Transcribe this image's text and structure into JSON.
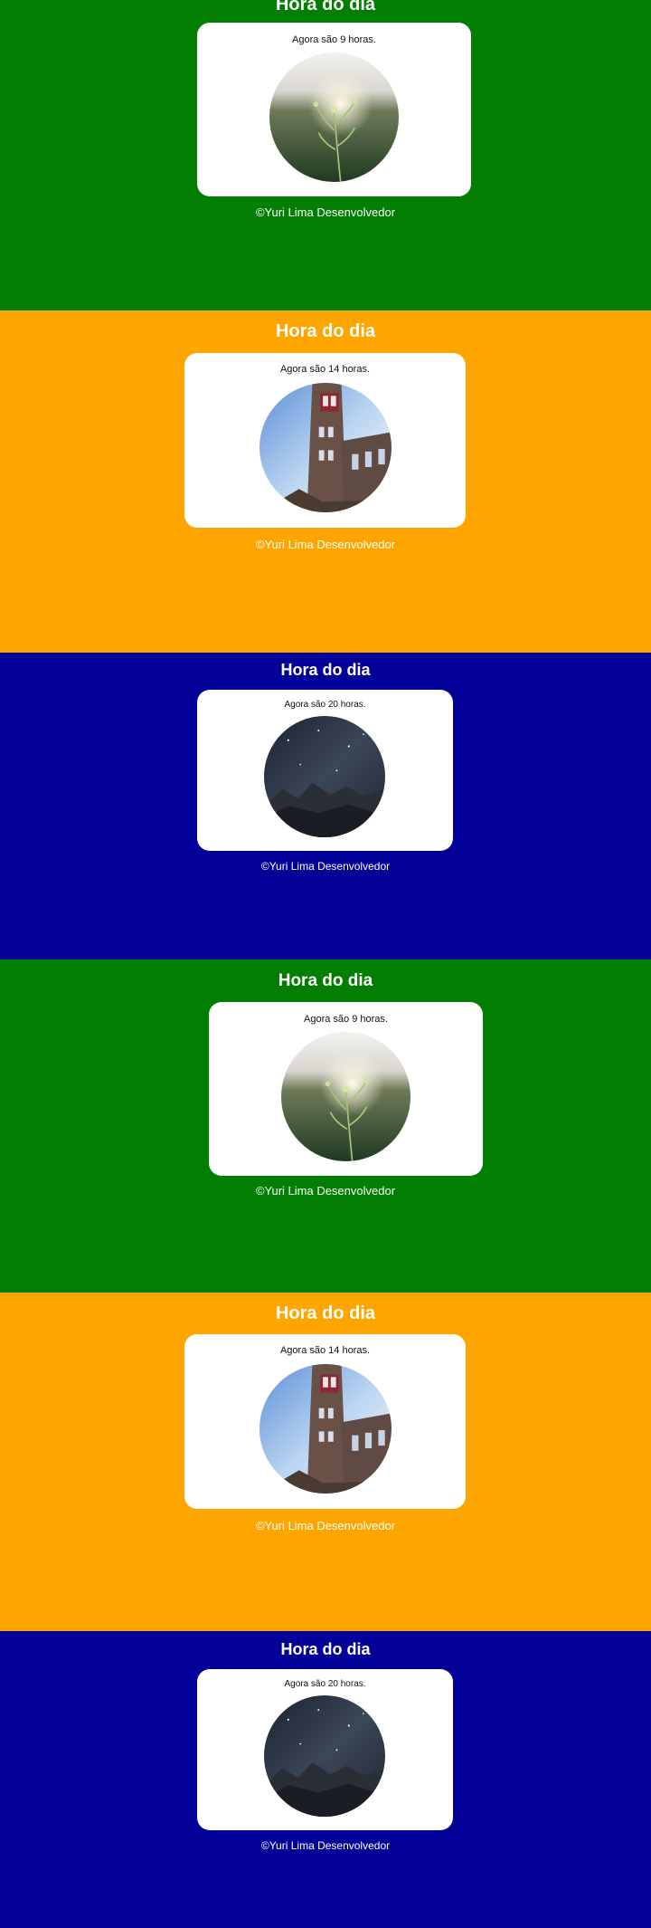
{
  "colors": {
    "morning_bg": "#027E02",
    "afternoon_bg": "#FFA500",
    "night_bg": "#020096",
    "card_bg": "#FFFFFF",
    "text_light": "#FFFFFF",
    "text_dark": "#111111"
  },
  "sections": [
    {
      "period": "morning",
      "title": "Hora do dia",
      "message": "Agora são 9 horas.",
      "image_icon": "sunrise-plant-photo",
      "footer": "©Yuri Lima Desenvolvedor"
    },
    {
      "period": "afternoon",
      "title": "Hora do dia",
      "message": "Agora são 14 horas.",
      "image_icon": "clock-tower-photo",
      "footer": "©Yuri Lima Desenvolvedor"
    },
    {
      "period": "night",
      "title": "Hora do dia",
      "message": "Agora são 20 horas.",
      "image_icon": "night-sky-mountains-photo",
      "footer": "©Yuri Lima Desenvolvedor"
    },
    {
      "period": "morning",
      "title": "Hora do dia",
      "message": "Agora são 9 horas.",
      "image_icon": "sunrise-plant-photo",
      "footer": "©Yuri Lima Desenvolvedor"
    },
    {
      "period": "afternoon",
      "title": "Hora do dia",
      "message": "Agora são 14 horas.",
      "image_icon": "clock-tower-photo",
      "footer": "©Yuri Lima Desenvolvedor"
    },
    {
      "period": "night",
      "title": "Hora do dia",
      "message": "Agora são 20 horas.",
      "image_icon": "night-sky-mountains-photo",
      "footer": "©Yuri Lima Desenvolvedor"
    }
  ]
}
